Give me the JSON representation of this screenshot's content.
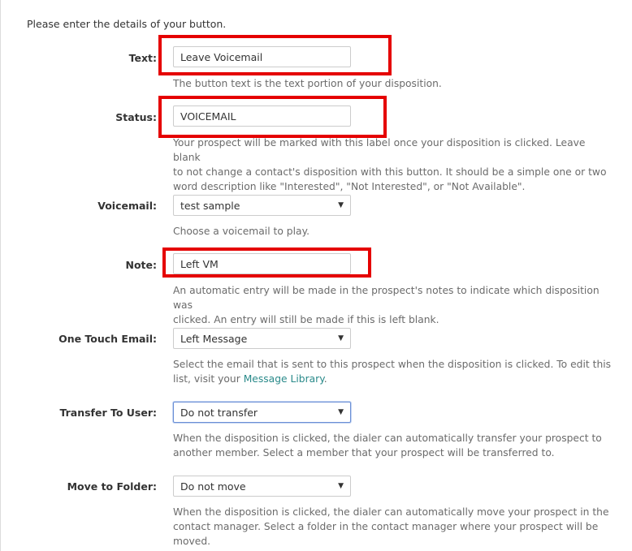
{
  "intro": "Please enter the details of your button.",
  "text_field": {
    "label": "Text:",
    "value": "Leave Voicemail",
    "help": "The button text is the text portion of your disposition."
  },
  "status_field": {
    "label": "Status:",
    "value": "VOICEMAIL",
    "help_line1": "Your prospect will be marked with this label once your disposition is clicked. Leave blank",
    "help_line2": "to not change a contact's disposition with this button. It should be a simple one or two",
    "help_line3": "word description like \"Interested\", \"Not Interested\", or \"Not Available\"."
  },
  "voicemail_field": {
    "label": "Voicemail:",
    "selected": "test sample",
    "help": "Choose a voicemail to play."
  },
  "note_field": {
    "label": "Note:",
    "value": "Left VM",
    "help_line1": "An automatic entry will be made in the prospect's notes to indicate which disposition was",
    "help_line2": "clicked. An entry will still be made if this is left blank."
  },
  "email_field": {
    "label": "One Touch Email:",
    "selected": "Left Message",
    "help_line1": "Select the email that is sent to this prospect when the disposition is clicked. To edit this",
    "help_line2_prefix": "list, visit your ",
    "help_link": "Message Library",
    "help_line2_suffix": "."
  },
  "transfer_field": {
    "label": "Transfer To User:",
    "selected": "Do not transfer",
    "help_line1": "When the disposition is clicked, the dialer can automatically transfer your prospect to",
    "help_line2": "another member. Select a member that your prospect will be transferred to."
  },
  "folder_field": {
    "label": "Move to Folder:",
    "selected": "Do not move",
    "help_line1": "When the disposition is clicked, the dialer can automatically move your prospect in the",
    "help_line2": "contact manager. Select a folder in the contact manager where your prospect will be",
    "help_line3": "moved."
  },
  "colors": {
    "highlight": "#e50000",
    "link": "#2a8a8a",
    "focus_border": "#6a8fd6"
  },
  "icons": {
    "dropdown": "caret-down-icon"
  }
}
